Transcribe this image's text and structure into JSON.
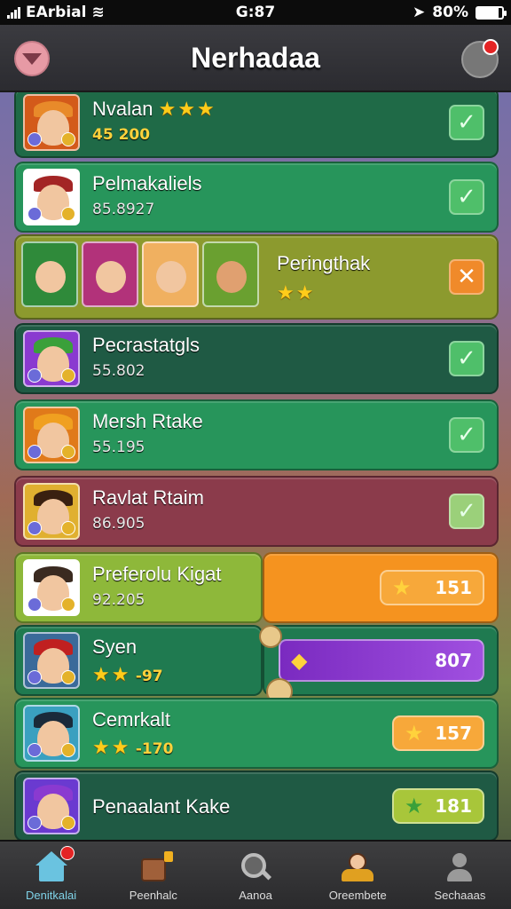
{
  "status": {
    "carrier": "EArbial",
    "time": "G:87",
    "battery": "80%"
  },
  "header": {
    "title": "Nerhadaa"
  },
  "rows": [
    {
      "name": "Nvalan",
      "stars": "★★★",
      "value": "45 200"
    },
    {
      "name": "Pelmakaliels",
      "value": "85.8927"
    },
    {
      "name": "Peringthak",
      "stars": "★★"
    },
    {
      "name": "Pecrastatgls",
      "value": "55.802"
    },
    {
      "name": "Mersh Rtake",
      "value": "55.195"
    },
    {
      "name": "Ravlat Rtaim",
      "value": "86.905"
    },
    {
      "name": "Preferolu Kigat",
      "value": "92.205",
      "pill_value": "151"
    },
    {
      "name": "Syen",
      "stars": "★★",
      "extra": "-97",
      "pill_value": "807"
    },
    {
      "name": "Cemrkalt",
      "stars": "★★",
      "extra": "-170",
      "pill_value": "157"
    },
    {
      "name": "Penaalant Kake",
      "pill_value": "181"
    }
  ],
  "nav": [
    {
      "label": "Denitkalai",
      "icon": "home-icon"
    },
    {
      "label": "Peenhalc",
      "icon": "chest-icon"
    },
    {
      "label": "Aanoa",
      "icon": "search-icon"
    },
    {
      "label": "Oreembete",
      "icon": "team-icon"
    },
    {
      "label": "Sechaaas",
      "icon": "profile-icon"
    }
  ],
  "colors": {
    "row_green": "#238a55",
    "row_dark": "#1f5a44",
    "row_olive": "#8d9a2e",
    "row_red": "#8b3b4b",
    "row_lime": "#8eb83a",
    "orange": "#f5931f",
    "purple": "#8a3ad0"
  }
}
